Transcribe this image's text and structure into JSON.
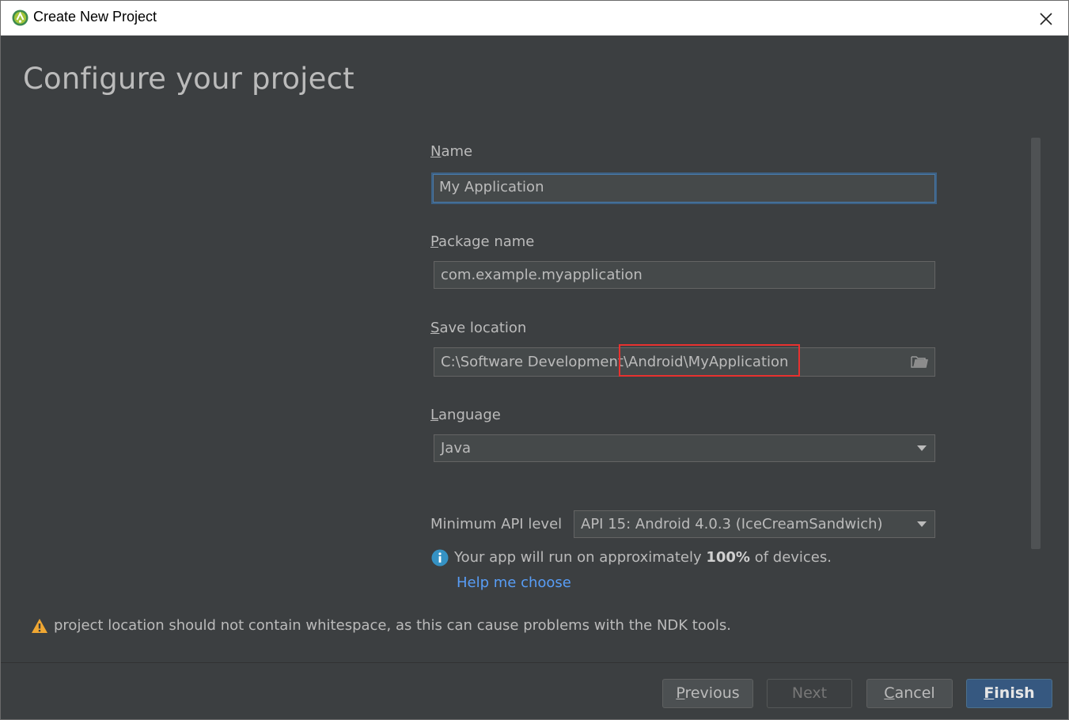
{
  "window": {
    "title": "Create New Project"
  },
  "page": {
    "heading": "Configure your project"
  },
  "form": {
    "name": {
      "label_key": "N",
      "label_rest": "ame",
      "value": "My Application"
    },
    "package": {
      "label_key": "P",
      "label_rest": "ackage name",
      "value": "com.example.myapplication"
    },
    "save_location": {
      "label_key": "S",
      "label_rest": "ave location",
      "value": "C:\\Software Development\\Android\\MyApplication"
    },
    "language": {
      "label_key": "L",
      "label_rest": "anguage",
      "value": "Java"
    },
    "min_api": {
      "label": "Minimum API level",
      "value": "API 15: Android 4.0.3 (IceCreamSandwich)"
    }
  },
  "info": {
    "prefix": "Your app will run on approximately ",
    "percent": "100%",
    "suffix": " of devices.",
    "help_link": "Help me choose"
  },
  "warning": {
    "text": "project location should not contain whitespace, as this can cause problems with the NDK tools."
  },
  "buttons": {
    "previous": {
      "key": "P",
      "rest": "revious"
    },
    "next": "Next",
    "cancel": {
      "key": "C",
      "rest": "ancel"
    },
    "finish": {
      "key": "F",
      "rest": "inish"
    }
  },
  "colors": {
    "background": "#3c3f41",
    "accent": "#365880",
    "link": "#589df6",
    "highlight": "#e8312f",
    "warning": "#f0a732",
    "info": "#3592c4"
  },
  "icons": {
    "app": "android-studio-icon",
    "close": "close-icon",
    "folder": "folder-icon",
    "dropdown": "chevron-down-icon",
    "info": "info-icon",
    "warning": "warning-icon"
  }
}
